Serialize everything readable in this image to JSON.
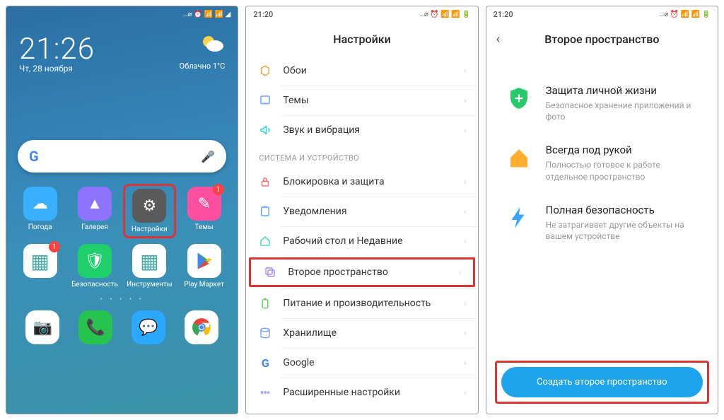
{
  "phone1": {
    "status_time": "",
    "clock": "21:26",
    "date": "Чт, 28 ноября",
    "weather_text": "Облачно  1°C",
    "apps": [
      {
        "label": "Погода",
        "color": "#38b0ff",
        "glyph": "☁",
        "badge": null
      },
      {
        "label": "Галерея",
        "color": "#8d73ff",
        "glyph": "▲",
        "badge": null
      },
      {
        "label": "Настройки",
        "color": "#5a5a5a",
        "glyph": "⚙",
        "badge": null,
        "highlight": true
      },
      {
        "label": "Темы",
        "color": "#ff4fa1",
        "glyph": "✎",
        "badge": "1"
      },
      {
        "label": "",
        "color": "#fff",
        "glyph": "▦",
        "badge": "1",
        "multi": true
      },
      {
        "label": "Безопасность",
        "color": "#1fcf6b",
        "glyph": "🛡",
        "badge": null
      },
      {
        "label": "Инструменты",
        "color": "#fff",
        "glyph": "▦",
        "badge": null,
        "multi": true
      },
      {
        "label": "Play Маркет",
        "color": "#fff",
        "glyph": "▶",
        "badge": null
      }
    ]
  },
  "phone2": {
    "status_time": "21:20",
    "title": "Настройки",
    "rows_top": [
      {
        "icon": "wallpaper",
        "color": "#ff9d2e",
        "label": "Обои"
      },
      {
        "icon": "themes",
        "color": "#6ea2ff",
        "label": "Темы"
      },
      {
        "icon": "sound",
        "color": "#2fd8c5",
        "label": "Звук и вибрация"
      }
    ],
    "section": "СИСТЕМА И УСТРОЙСТВО",
    "rows_sys": [
      {
        "icon": "lock",
        "color": "#ff6e6e",
        "label": "Блокировка и защита"
      },
      {
        "icon": "notif",
        "color": "#5aa9ff",
        "label": "Уведомления"
      },
      {
        "icon": "home",
        "color": "#4fd6c1",
        "label": "Рабочий стол и Недавние"
      },
      {
        "icon": "second",
        "color": "#a88cff",
        "label": "Второе пространство",
        "highlight": true
      },
      {
        "icon": "power",
        "color": "#6ecf6e",
        "label": "Питание и производительность"
      },
      {
        "icon": "storage",
        "color": "#7aa6ff",
        "label": "Хранилище"
      },
      {
        "icon": "google",
        "color": "",
        "label": "Google"
      },
      {
        "icon": "more",
        "color": "#9aa1ff",
        "label": "Расширенные настройки"
      }
    ]
  },
  "phone3": {
    "status_time": "21:20",
    "title": "Второе пространство",
    "features": [
      {
        "title": "Защита личной жизни",
        "desc": "Безопасное хранение приложений и фото",
        "icon": "shield",
        "color": "#29c96b"
      },
      {
        "title": "Всегда под рукой",
        "desc": "Полностью готовое к работе отдельное пространство",
        "icon": "house",
        "color": "#ffae2e"
      },
      {
        "title": "Полная безопасность",
        "desc": "Не затрагивает другие объекты на вашем устройстве",
        "icon": "bolt",
        "color": "#3aa6ff"
      }
    ],
    "cta": "Создать второе пространство"
  }
}
